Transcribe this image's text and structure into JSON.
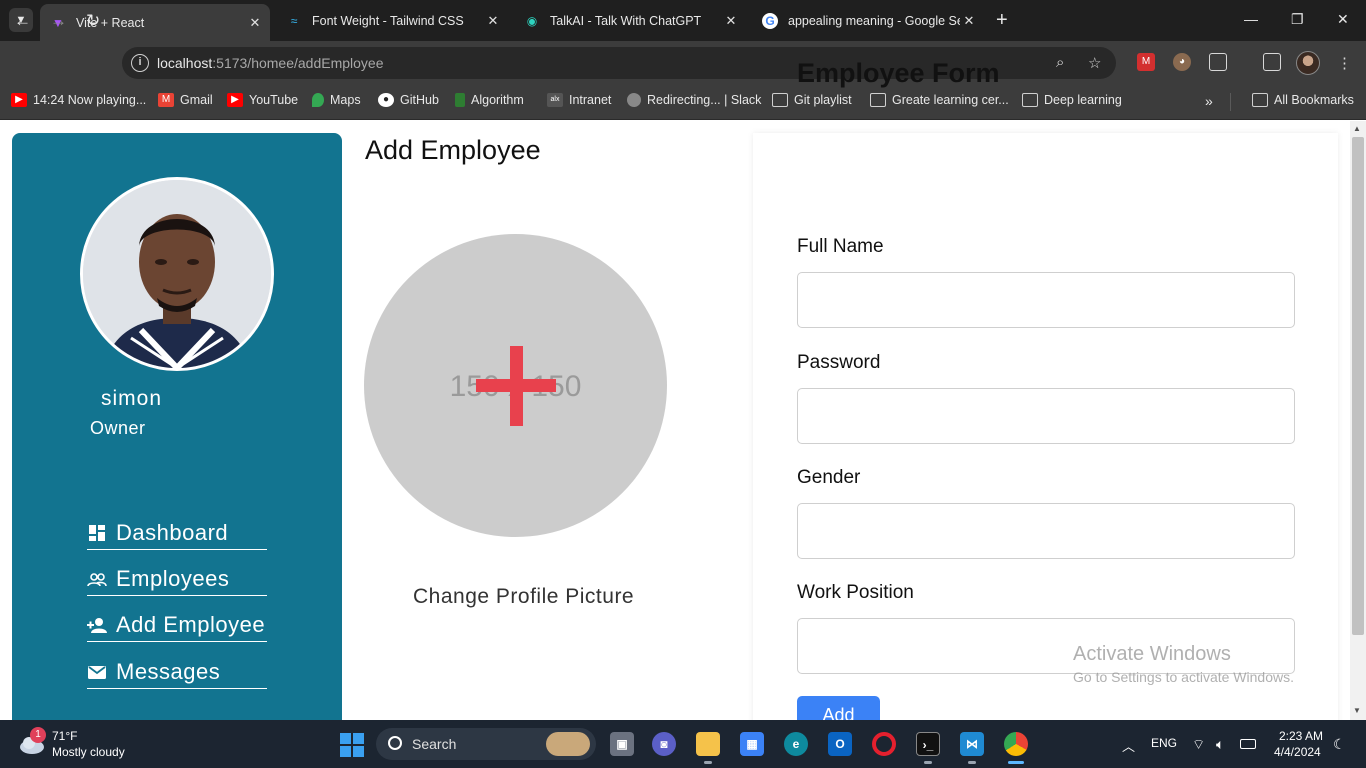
{
  "browser": {
    "tabs": [
      {
        "title": "Vite + React",
        "icon": "vite-icon",
        "active": true
      },
      {
        "title": "Font Weight - Tailwind CSS",
        "icon": "tailwind-icon",
        "active": false
      },
      {
        "title": "TalkAI - Talk With ChatGPT",
        "icon": "talkai-icon",
        "active": false
      },
      {
        "title": "appealing meaning - Google Se",
        "icon": "google-icon",
        "active": false
      }
    ],
    "url_host": "localhost",
    "url_rest": ":5173/homee/addEmployee",
    "bookmarks": [
      {
        "label": "14:24 Now playing...",
        "icon": "youtube-icon",
        "color": "#ff0000"
      },
      {
        "label": "Gmail",
        "icon": "gmail-icon",
        "color": "#ea4335"
      },
      {
        "label": "YouTube",
        "icon": "youtube-icon",
        "color": "#ff0000"
      },
      {
        "label": "Maps",
        "icon": "maps-icon",
        "color": "#34a853"
      },
      {
        "label": "GitHub",
        "icon": "github-icon",
        "color": "#ffffff"
      },
      {
        "label": "Algorithm",
        "icon": "algorithm-icon",
        "color": "#2e7d32"
      },
      {
        "label": "Intranet",
        "icon": "intranet-icon",
        "color": "#555555"
      },
      {
        "label": "Redirecting... | Slack",
        "icon": "globe-icon",
        "color": "#888888"
      },
      {
        "label": "Git playlist",
        "icon": "folder-icon",
        "color": "#d0d0d0"
      },
      {
        "label": "Greate learning cer...",
        "icon": "folder-icon",
        "color": "#d0d0d0"
      },
      {
        "label": "Deep learning",
        "icon": "folder-icon",
        "color": "#d0d0d0"
      }
    ],
    "all_bookmarks": "All Bookmarks"
  },
  "sidebar": {
    "username": "simon",
    "role": "Owner",
    "nav": [
      {
        "label": "Dashboard",
        "icon": "dashboard-icon"
      },
      {
        "label": "Employees",
        "icon": "employees-icon"
      },
      {
        "label": "Add Employee",
        "icon": "add-user-icon"
      },
      {
        "label": "Messages",
        "icon": "mail-icon"
      }
    ]
  },
  "main": {
    "title": "Add Employee",
    "placeholder_text": "150 x 150",
    "change_picture": "Change Profile Picture"
  },
  "form": {
    "title": "Employee Form",
    "fields": [
      {
        "label": "Full Name",
        "value": ""
      },
      {
        "label": "Password",
        "value": ""
      },
      {
        "label": "Gender",
        "value": ""
      },
      {
        "label": "Work Position",
        "value": ""
      }
    ],
    "submit_label": "Add"
  },
  "watermark": {
    "title": "Activate Windows",
    "subtitle": "Go to Settings to activate Windows."
  },
  "taskbar": {
    "weather_badge": "1",
    "temperature": "71°F",
    "weather": "Mostly cloudy",
    "search_label": "Search",
    "language": "ENG",
    "time": "2:23 AM",
    "date": "4/4/2024"
  },
  "colors": {
    "sidebar": "#127490",
    "plus": "#e8414d",
    "button": "#3b82f6"
  }
}
